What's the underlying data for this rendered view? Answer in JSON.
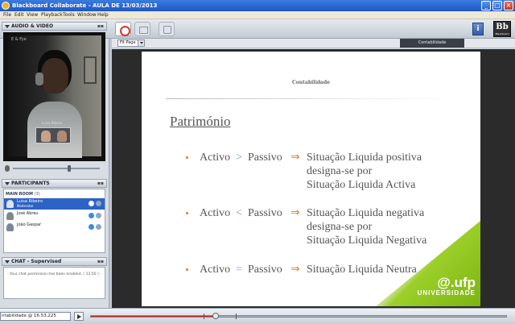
{
  "window": {
    "title": "Blackboard Collaborate - AULA DE 13/03/2013",
    "minimize": "_",
    "maximize": "□",
    "close": "×"
  },
  "menu": [
    "File",
    "Edit",
    "View",
    "Playback",
    "Tools",
    "Window",
    "Help"
  ],
  "toolbar": {
    "info_label": "i",
    "logo_text": "Bb",
    "logo_sub": "Blackboard"
  },
  "audio_video": {
    "title": "AUDIO & VIDEO",
    "video_name": "E & Fye",
    "video_caption": "Luisa Ribeiro"
  },
  "participants": {
    "title": "PARTICIPANTS",
    "room_label": "MAIN ROOM",
    "room_count": "(3)",
    "list": [
      {
        "name": "Luisa Ribeiro",
        "role": "Moderator",
        "selected": true
      },
      {
        "name": "José Abreu",
        "role": "",
        "selected": false
      },
      {
        "name": "João Gaspar",
        "role": "",
        "selected": false
      }
    ]
  },
  "chat": {
    "title": "CHAT - Supervised",
    "message": "- Your chat permission has been enabled. ( 12:50 ) -"
  },
  "whiteboard": {
    "zoom_value": "Fit Page",
    "page_tab": "Contabilidade"
  },
  "slide": {
    "header": "Contabilidade",
    "title": "Património",
    "bullets": [
      {
        "lhs_a": "Activo",
        "op": ">",
        "lhs_b": "Passivo",
        "arrow": "⇒",
        "rhs": [
          "Situação Liquida positiva",
          "designa-se por",
          "Situação Liquida Activa"
        ]
      },
      {
        "lhs_a": "Activo",
        "op": "<",
        "lhs_b": "Passivo",
        "arrow": "⇒",
        "rhs": [
          "Situação Liquida negativa",
          "designa-se por",
          "Situação Liquida Negativa"
        ]
      },
      {
        "lhs_a": "Activo",
        "op": "=",
        "lhs_b": "Passivo",
        "arrow": "⇒",
        "rhs": [
          "Situação Liquida Neutra"
        ]
      }
    ],
    "logo_line1": "@.ufp",
    "logo_line2": "UNIVERSIDADE"
  },
  "playback": {
    "time_label": "ntabilidade @ 16:53.225",
    "progress": 0.3
  }
}
